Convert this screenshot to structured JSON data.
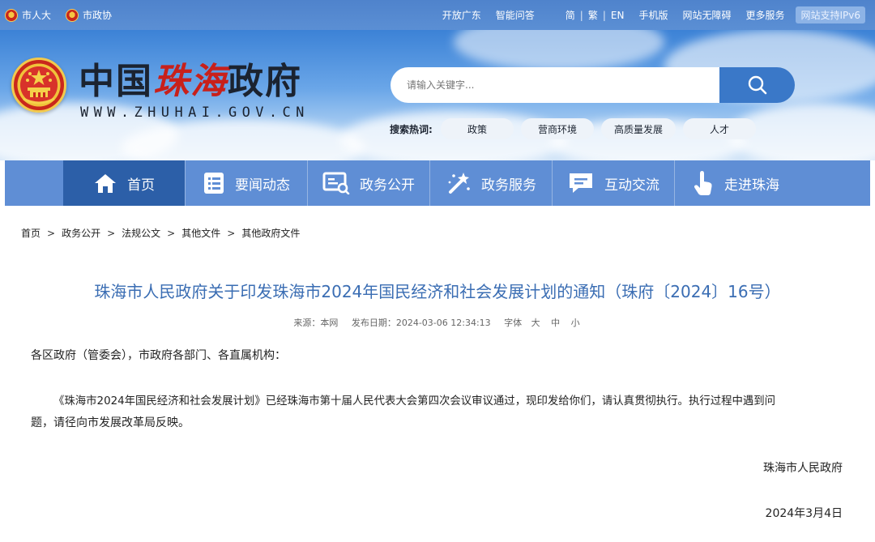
{
  "topbar": {
    "left_links": [
      "市人大",
      "市政协"
    ],
    "right_links": [
      "开放广东",
      "智能问答"
    ],
    "lang": [
      "简",
      "繁",
      "EN"
    ],
    "tools": [
      "手机版",
      "网站无障碍",
      "更多服务"
    ],
    "ipv6": "网站支持IPv6"
  },
  "header": {
    "name_a": "中国",
    "name_b": "珠海",
    "name_c": "政府",
    "url": "WWW.ZHUHAI.GOV.CN"
  },
  "search": {
    "placeholder": "请输入关键字...",
    "hot_label": "搜索热词:",
    "hot_words": [
      "政策",
      "营商环境",
      "高质量发展",
      "人才"
    ]
  },
  "nav": {
    "items": [
      {
        "label": "首页",
        "icon": "home-icon"
      },
      {
        "label": "要闻动态",
        "icon": "news-icon"
      },
      {
        "label": "政务公开",
        "icon": "disclosure-icon"
      },
      {
        "label": "政务服务",
        "icon": "service-icon"
      },
      {
        "label": "互动交流",
        "icon": "chat-icon"
      },
      {
        "label": "走进珠海",
        "icon": "hand-icon"
      }
    ]
  },
  "breadcrumb": [
    "首页",
    "政务公开",
    "法规公文",
    "其他文件",
    "其他政府文件"
  ],
  "article": {
    "title": "珠海市人民政府关于印发珠海市2024年国民经济和社会发展计划的通知（珠府〔2024〕16号）",
    "source": "来源：本网",
    "date": "发布日期：2024-03-06 12:34:13",
    "font_label": "字体",
    "font_sizes": [
      "大",
      "中",
      "小"
    ],
    "salutation": "各区政府（管委会），市政府各部门、各直属机构：",
    "body_line1": "《珠海市2024年国民经济和社会发展计划》已经珠海市第十届人民代表大会第四次会议审议通过，现印发给你们，请认真贯彻执行。执行过程中遇到问",
    "body_line2": "题，请径向市发展改革局反映。",
    "signature": "珠海市人民政府",
    "sign_date": "2024年3月4日"
  },
  "colors": {
    "topbar": "#5b8fd4",
    "nav": "#5f8ed5",
    "nav_active": "#2c5fa8",
    "title": "#3a6db3",
    "brand_red": "#c8201b"
  }
}
